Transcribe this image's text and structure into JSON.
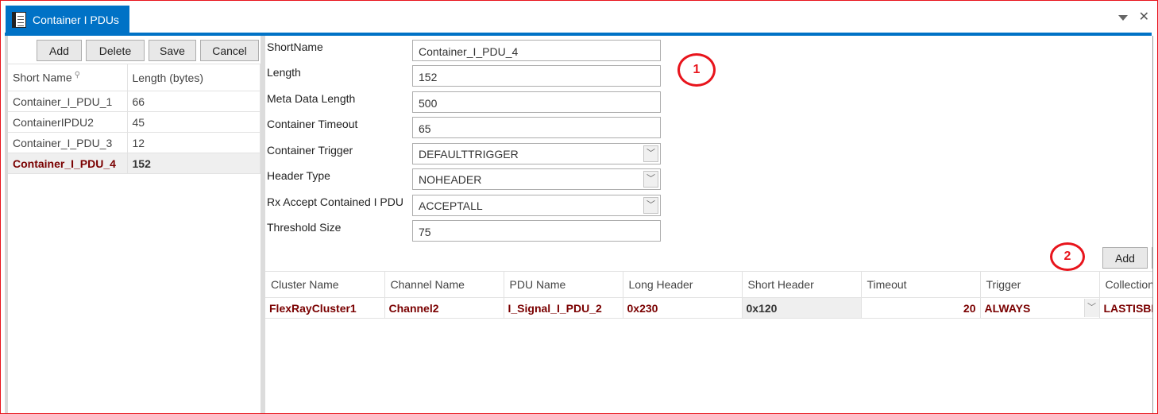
{
  "window": {
    "tab_title": "Container I PDUs",
    "icons": {
      "tab": "document-icon",
      "menu": "dropdown-triangle-icon",
      "close": "close-icon"
    }
  },
  "left_panel": {
    "toolbar": {
      "add": "Add",
      "delete": "Delete",
      "save": "Save",
      "cancel": "Cancel"
    },
    "columns": [
      "Short Name",
      "Length (bytes)"
    ],
    "rows": [
      {
        "short_name": "Container_I_PDU_1",
        "length": "66",
        "selected": false
      },
      {
        "short_name": "ContainerIPDU2",
        "length": "45",
        "selected": false
      },
      {
        "short_name": "Container_I_PDU_3",
        "length": "12",
        "selected": false
      },
      {
        "short_name": "Container_I_PDU_4",
        "length": "152",
        "selected": true
      }
    ]
  },
  "form": {
    "short_name": {
      "label": "ShortName",
      "value": "Container_I_PDU_4"
    },
    "length": {
      "label": "Length",
      "value": "152"
    },
    "meta_data_length": {
      "label": "Meta Data Length",
      "value": "500"
    },
    "container_timeout": {
      "label": "Container Timeout",
      "value": "65"
    },
    "container_trigger": {
      "label": "Container Trigger",
      "value": "DEFAULTTRIGGER"
    },
    "header_type": {
      "label": "Header Type",
      "value": "NOHEADER"
    },
    "rx_accept": {
      "label": "Rx Accept Contained I PDU",
      "value": "ACCEPTALL"
    },
    "threshold_size": {
      "label": "Threshold Size",
      "value": "75"
    }
  },
  "annotations": {
    "one": "1",
    "two": "2"
  },
  "contained_pdus": {
    "add_label": "Add",
    "columns": [
      "Cluster Name",
      "Channel Name",
      "PDU Name",
      "Long Header",
      "Short Header",
      "Timeout",
      "Trigger",
      "Collection"
    ],
    "rows": [
      {
        "cluster_name": "FlexRayCluster1",
        "channel_name": "Channel2",
        "pdu_name": "I_Signal_I_PDU_2",
        "long_header": "0x230",
        "short_header": "0x120",
        "timeout": "20",
        "trigger": "ALWAYS",
        "collection": "LASTISBEST"
      }
    ]
  },
  "colors": {
    "accent": "#0072c6",
    "selected_text": "#7a0000",
    "annotation": "#e8141c"
  }
}
